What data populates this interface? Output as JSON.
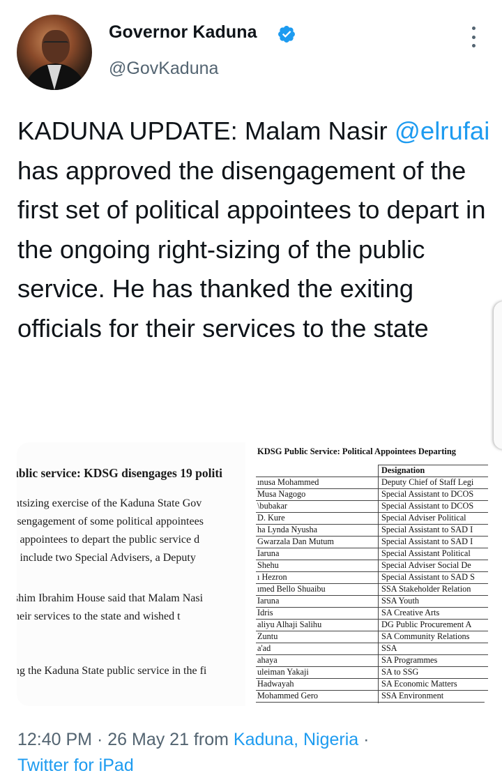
{
  "author": {
    "name": "Governor Kaduna",
    "handle": "@GovKaduna",
    "verified": true,
    "avatar_icon": "profile-photo-icon",
    "more_icon": "more-vertical-icon"
  },
  "tweet": {
    "text_before": "KADUNA UPDATE: Malam Nasir ",
    "mention": "@elrufai",
    "text_after": " has approved the disengagement of the first set of political appointees to depart in the ongoing right-sizing of the public service. He has thanked the exiting officials for their services to the state"
  },
  "media": {
    "left": {
      "title": "ıblic service: KDSG disengages 19 politi",
      "lines": [
        "htsizing exercise of the Kaduna State Gov",
        "isengagement of some political appointees",
        "l appointees to depart the public service d",
        "; include two Special Advisers, a Deputy",
        "shim Ibrahim House said that Malam Nasi",
        "heir services to the state and wished t",
        "ng the Kaduna State public service in the fi"
      ]
    },
    "right": {
      "title": "KDSG Public Service: Political Appointees Departing",
      "column_header": "Designation",
      "rows": [
        {
          "name": "ınusa Mohammed",
          "designation": "Deputy Chief of Staff Legi"
        },
        {
          "name": "Musa Nagogo",
          "designation": "Special Assistant to DCOS"
        },
        {
          "name": "\\bubakar",
          "designation": "Special Assistant to DCOS"
        },
        {
          "name": "D. Kure",
          "designation": "Special Adviser Political"
        },
        {
          "name": "ha Lynda Nyusha",
          "designation": "Special Assistant to SAD I"
        },
        {
          "name": "Gwarzala Dan Mutum",
          "designation": "Special Assistant to SAD I"
        },
        {
          "name": "Iaruna",
          "designation": "Special Assistant Political"
        },
        {
          "name": "Shehu",
          "designation": "Special Adviser Social De"
        },
        {
          "name": "ı Hezron",
          "designation": "Special Assistant to SAD S"
        },
        {
          "name": "ımed Bello Shuaibu",
          "designation": "SSA Stakeholder Relation"
        },
        {
          "name": "Iaruna",
          "designation": "SSA Youth"
        },
        {
          "name": "Idris",
          "designation": "SA Creative Arts"
        },
        {
          "name": "aliyu Alhaji Salihu",
          "designation": "DG Public Procurement A"
        },
        {
          "name": "Zuntu",
          "designation": "SA Community Relations"
        },
        {
          "name": "a'ad",
          "designation": "SSA"
        },
        {
          "name": "ahaya",
          "designation": "SA Programmes"
        },
        {
          "name": "uleiman Yakaji",
          "designation": "SA to SSG"
        },
        {
          "name": "Hadwayah",
          "designation": "SA Economic Matters"
        },
        {
          "name": "Mohammed Gero",
          "designation": "SSA Environment"
        }
      ]
    }
  },
  "meta": {
    "time": "12:40 PM",
    "separator": " · ",
    "date": "26 May 21",
    "from_label": " from ",
    "location": "Kaduna, Nigeria",
    "trailing_separator": " ·",
    "source": "Twitter for iPad"
  },
  "colors": {
    "link": "#1d9bf0",
    "secondary_text": "#536471",
    "primary_text": "#0f1419"
  }
}
